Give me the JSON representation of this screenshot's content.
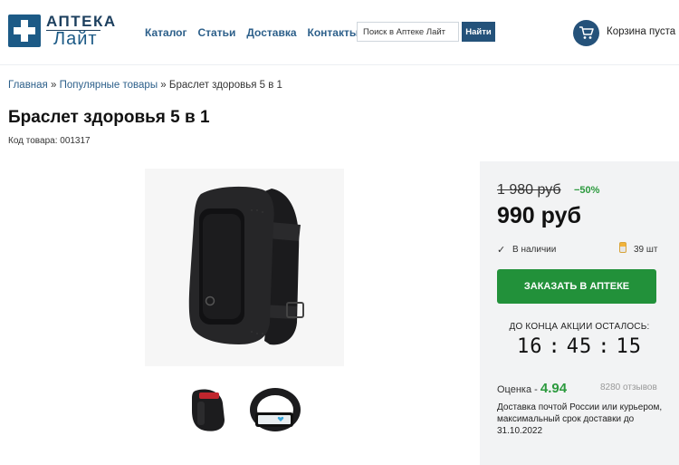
{
  "header": {
    "logo_line1": "АПТЕКА",
    "logo_line2": "Лайт",
    "nav": [
      "Каталог",
      "Статьи",
      "Доставка",
      "Контакты"
    ],
    "search_placeholder": "Поиск в Аптеке Лайт",
    "search_button": "Найти",
    "cart_text": "Корзина пуста",
    "accent_color": "#24527a"
  },
  "breadcrumb": {
    "home": "Главная",
    "separator": "»",
    "category": "Популярные товары",
    "current": "Браслет здоровья 5 в 1"
  },
  "product": {
    "title": "Браслет здоровья 5 в 1",
    "sku_label": "Код товара: 001317",
    "images": [
      "fitness-band-main",
      "fitness-band-red-thumb",
      "fitness-band-display-thumb"
    ]
  },
  "offer": {
    "old_price": "1 980 руб",
    "discount": "−50%",
    "price": "990 руб",
    "stock_check": "✓",
    "stock_text": "В наличии",
    "quantity": "39 шт",
    "order_button": "ЗАКАЗАТЬ В АПТЕКЕ",
    "order_color": "#22913a",
    "promo_label": "ДО КОНЦА АКЦИИ ОСТАЛОСЬ:",
    "timer": {
      "hours": "16",
      "minutes": "45",
      "seconds": "15",
      "separator": ":"
    },
    "rating_label": "Оценка - ",
    "rating_value": "4.94",
    "reviews": "8280 отзывов",
    "delivery": "Доставка почтой России или курьером, максимальный срок доставки до 31.10.2022"
  }
}
